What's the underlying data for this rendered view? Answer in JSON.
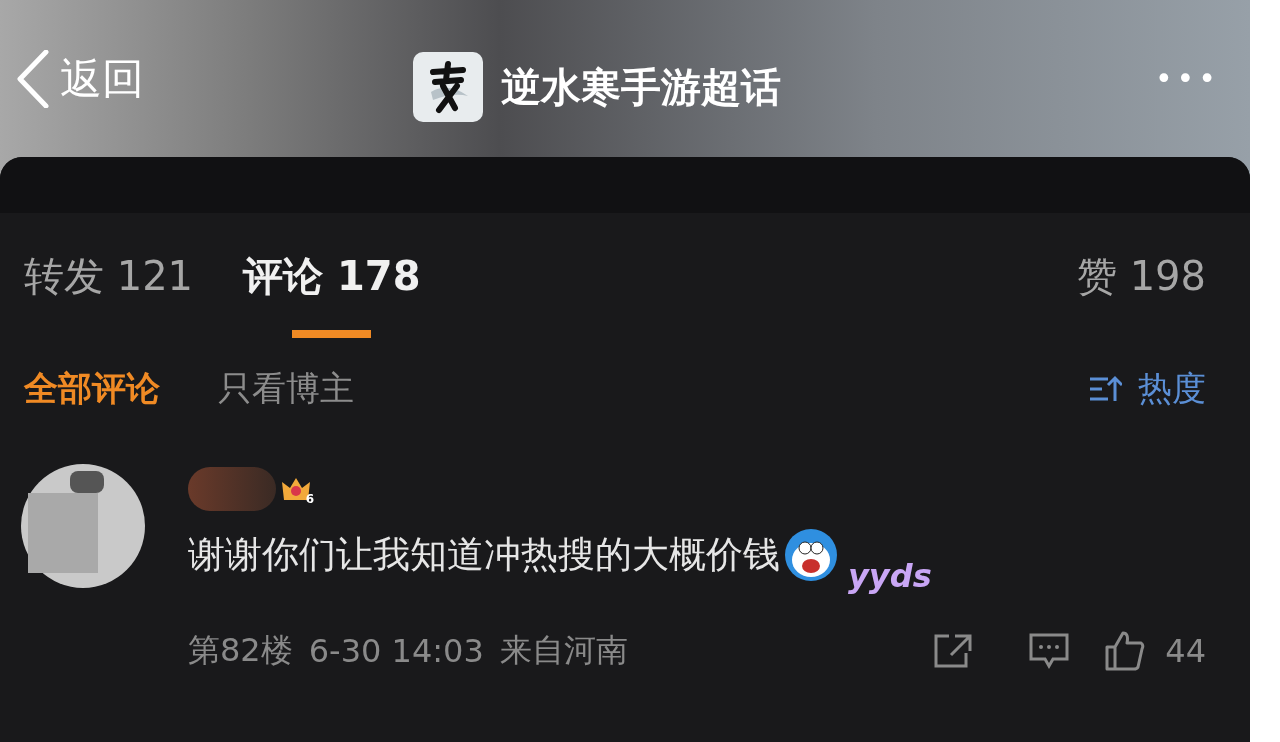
{
  "header": {
    "back": "返回",
    "title": "逆水寒手游超话",
    "more": "•••"
  },
  "tabs": [
    {
      "label": "转发 121",
      "selected": false
    },
    {
      "label": "评论 178",
      "selected": true
    }
  ],
  "likes_tab": {
    "label": "赞 198"
  },
  "filters": [
    {
      "label": "全部评论",
      "selected": true
    },
    {
      "label": "只看博主",
      "selected": false
    }
  ],
  "sort": {
    "label": "热度"
  },
  "comments": [
    {
      "badge_level": "6",
      "text": "谢谢你们让我知道冲热搜的大概价钱",
      "sticker": "yyds",
      "floor": "第82楼",
      "time": "6-30 14:03",
      "location": "来自河南",
      "likes": "44"
    }
  ]
}
